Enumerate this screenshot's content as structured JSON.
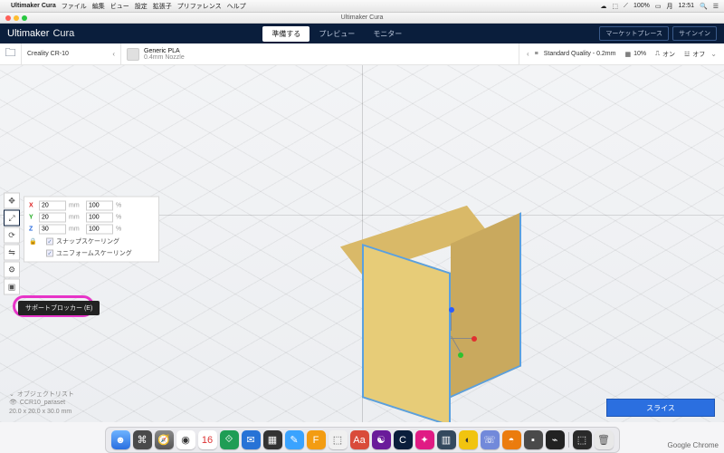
{
  "mac": {
    "app": "Ultimaker Cura",
    "menus": [
      "ファイル",
      "編集",
      "ビュー",
      "設定",
      "拡張子",
      "プリファレンス",
      "ヘルプ"
    ],
    "battery": "100%",
    "day": "月",
    "time": "12:51"
  },
  "window": {
    "title": "Ultimaker Cura"
  },
  "brand": {
    "a": "Ultimaker",
    "b": "Cura"
  },
  "stages": {
    "prepare": "準備する",
    "preview": "プレビュー",
    "monitor": "モニター"
  },
  "header_buttons": {
    "marketplace": "マーケットプレース",
    "signin": "サインイン"
  },
  "config": {
    "printer": "Creality CR-10",
    "material_name": "Generic PLA",
    "nozzle": "0.4mm Nozzle",
    "profile": "Standard Quality - 0.2mm",
    "infill": "10%",
    "on": "オン",
    "off": "オフ"
  },
  "scale": {
    "x": {
      "abs": "20",
      "unit": "mm",
      "pct": "100",
      "pctu": "%"
    },
    "y": {
      "abs": "20",
      "unit": "mm",
      "pct": "100",
      "pctu": "%"
    },
    "z": {
      "abs": "30",
      "unit": "mm",
      "pct": "100",
      "pctu": "%"
    },
    "snap": "スナップスケーリング",
    "uniform": "ユニフォームスケーリング"
  },
  "tooltip": "サポートブロッカー (E)",
  "object_list": "オブジェクトリスト",
  "object_name": "CCR10_paraset",
  "dims": "20.0 x 20.0 x 30.0 mm",
  "slice": "スライス",
  "dock_label": "Google Chrome"
}
